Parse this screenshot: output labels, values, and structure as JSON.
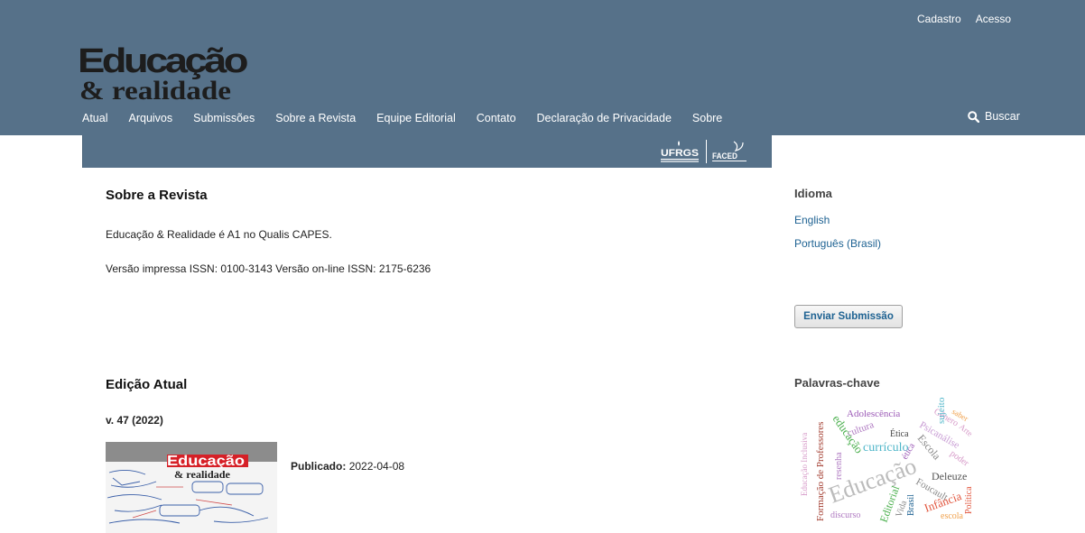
{
  "user_nav": {
    "register": "Cadastro",
    "login": "Acesso"
  },
  "logo": {
    "line1": "Educação",
    "line2": "& realidade"
  },
  "nav": {
    "items": [
      "Atual",
      "Arquivos",
      "Submissões",
      "Sobre a Revista",
      "Equipe Editorial",
      "Contato",
      "Declaração de Privacidade",
      "Sobre"
    ],
    "search_label": "Buscar"
  },
  "banner": {
    "logo1": "UFRGS",
    "logo2": "FACED"
  },
  "about": {
    "title": "Sobre a Revista",
    "line1": "Educação & Realidade é A1 no Qualis CAPES.",
    "line2": "Versão impressa ISSN: 0100-3143 Versão on-line ISSN: 2175-6236"
  },
  "current_issue": {
    "title": "Edição Atual",
    "volume": "v. 47 (2022)",
    "published_label": "Publicado:",
    "published_date": "2022-04-08"
  },
  "sidebar": {
    "language_title": "Idioma",
    "languages": [
      "English",
      "Português (Brasil)"
    ],
    "submit_label": "Enviar Submissão",
    "keywords_title": "Palavras-chave",
    "keywords": [
      "Gênero",
      "sujeito",
      "saber",
      "Adolescência",
      "Psicanálise",
      "Arte",
      "cultura",
      "Ética",
      "educação",
      "currículo",
      "Escola",
      "Formação de Professores",
      "Educação Inclusiva",
      "resenha",
      "ética",
      "poder",
      "Deleuze",
      "Educação",
      "Foucault",
      "Brasil",
      "Editorial",
      "Vida",
      "Infância",
      "Política",
      "discurso",
      "escola"
    ]
  }
}
